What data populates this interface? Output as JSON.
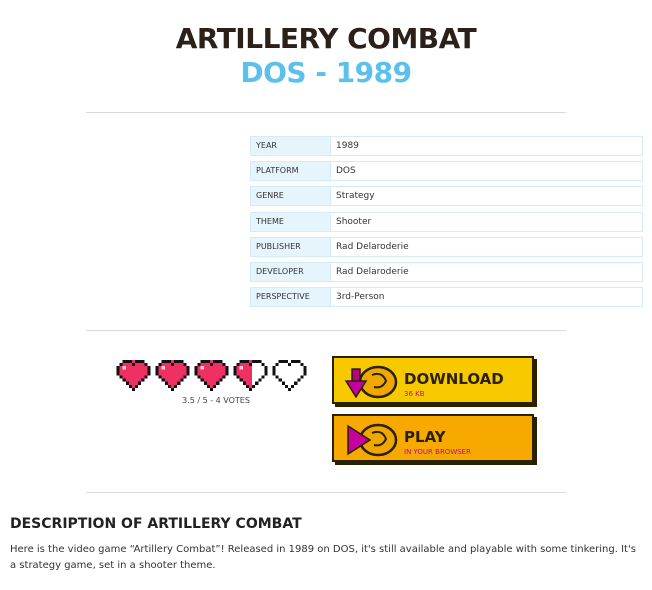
{
  "game": {
    "title": "ARTILLERY COMBAT",
    "subtitle": "DOS - 1989"
  },
  "info": [
    {
      "label": "YEAR",
      "value": "1989"
    },
    {
      "label": "PLATFORM",
      "value": "DOS"
    },
    {
      "label": "GENRE",
      "value": "Strategy"
    },
    {
      "label": "THEME",
      "value": "Shooter"
    },
    {
      "label": "PUBLISHER",
      "value": "Rad Delaroderie"
    },
    {
      "label": "DEVELOPER",
      "value": "Rad Delaroderie"
    },
    {
      "label": "PERSPECTIVE",
      "value": "3rd-Person"
    }
  ],
  "rating": {
    "score": 3.5,
    "max": 5,
    "text": "3.5 / 5 - 4 VOTES",
    "heart_color": "#ee3063"
  },
  "buttons": {
    "download": {
      "label": "DOWNLOAD",
      "sub": "36 KB",
      "icon": "download-arrow-icon"
    },
    "play": {
      "label": "PLAY",
      "sub": "IN YOUR BROWSER",
      "icon": "play-triangle-icon"
    }
  },
  "description": {
    "title": "DESCRIPTION OF ARTILLERY COMBAT",
    "text": "Here is the video game “Artillery Combat”! Released in 1989 on DOS, it's still available and playable with some tinkering. It's a strategy game, set in a shooter theme."
  },
  "colors": {
    "title": "#2b2118",
    "subtitle": "#5bc0eb",
    "download_bg": "#f9c900",
    "play_bg": "#f7a900",
    "accent": "#c6009c"
  }
}
